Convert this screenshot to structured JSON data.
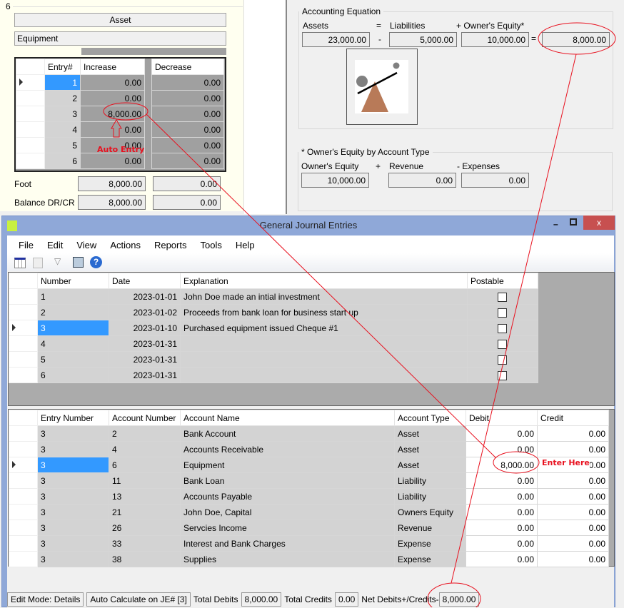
{
  "account_panel": {
    "number": "6",
    "type": "Asset",
    "name": "Equipment",
    "columns": [
      "Entry#",
      "Increase",
      "Decrease"
    ],
    "rows": [
      {
        "entry": "1",
        "inc": "0.00",
        "dec": "0.00"
      },
      {
        "entry": "2",
        "inc": "0.00",
        "dec": "0.00"
      },
      {
        "entry": "3",
        "inc": "8,000.00",
        "dec": "0.00"
      },
      {
        "entry": "4",
        "inc": "0.00",
        "dec": "0.00"
      },
      {
        "entry": "5",
        "inc": "0.00",
        "dec": "0.00"
      },
      {
        "entry": "6",
        "inc": "0.00",
        "dec": "0.00"
      }
    ],
    "foot_label": "Foot",
    "foot_inc": "8,000.00",
    "foot_dec": "0.00",
    "balance_label": "Balance DR/CR",
    "balance_inc": "8,000.00",
    "balance_dec": "0.00",
    "annotation": "Auto Entry"
  },
  "equation": {
    "title": "Accounting Equation",
    "assets_label": "Assets",
    "eq1": "=",
    "liab_label": "Liabilities",
    "oe_label": "+ Owner's Equity*",
    "assets": "23,000.00",
    "minus": "-",
    "liabilities": "5,000.00",
    "owners_equity": "10,000.00",
    "eq2": "=",
    "result": "8,000.00"
  },
  "oe_by_type": {
    "title": "* Owner's Equity by Account  Type",
    "oe_label": "Owner's Equity",
    "plus": "+",
    "rev_label": "Revenue",
    "exp_label": "- Expenses",
    "oe": "10,000.00",
    "revenue": "0.00",
    "expenses": "0.00"
  },
  "window": {
    "title": "General Journal Entries",
    "menu": [
      "File",
      "Edit",
      "View",
      "Actions",
      "Reports",
      "Tools",
      "Help"
    ]
  },
  "journal": {
    "columns": [
      "Number",
      "Date",
      "Explanation",
      "Postable"
    ],
    "rows": [
      {
        "n": "1",
        "d": "2023-01-01",
        "e": "John Doe made an intial investment"
      },
      {
        "n": "2",
        "d": "2023-01-02",
        "e": "Proceeds from bank loan for business start up"
      },
      {
        "n": "3",
        "d": "2023-01-10",
        "e": "Purchased equipment issued Cheque #1"
      },
      {
        "n": "4",
        "d": "2023-01-31",
        "e": ""
      },
      {
        "n": "5",
        "d": "2023-01-31",
        "e": ""
      },
      {
        "n": "6",
        "d": "2023-01-31",
        "e": ""
      }
    ]
  },
  "details": {
    "columns": [
      "Entry Number",
      "Account Number",
      "Account Name",
      "Account Type",
      "Debit",
      "Credit"
    ],
    "rows": [
      {
        "en": "3",
        "an": "2",
        "name": "Bank Account",
        "type": "Asset",
        "dr": "0.00",
        "cr": "0.00"
      },
      {
        "en": "3",
        "an": "4",
        "name": "Accounts Receivable",
        "type": "Asset",
        "dr": "0.00",
        "cr": "0.00"
      },
      {
        "en": "3",
        "an": "6",
        "name": "Equipment",
        "type": "Asset",
        "dr": "8,000.00",
        "cr": "0.00"
      },
      {
        "en": "3",
        "an": "11",
        "name": "Bank Loan",
        "type": "Liability",
        "dr": "0.00",
        "cr": "0.00"
      },
      {
        "en": "3",
        "an": "13",
        "name": "Accounts Payable",
        "type": "Liability",
        "dr": "0.00",
        "cr": "0.00"
      },
      {
        "en": "3",
        "an": "21",
        "name": "John Doe, Capital",
        "type": "Owners Equity",
        "dr": "0.00",
        "cr": "0.00"
      },
      {
        "en": "3",
        "an": "26",
        "name": "Servcies Income",
        "type": "Revenue",
        "dr": "0.00",
        "cr": "0.00"
      },
      {
        "en": "3",
        "an": "33",
        "name": "Interest and Bank Charges",
        "type": "Expense",
        "dr": "0.00",
        "cr": "0.00"
      },
      {
        "en": "3",
        "an": "38",
        "name": "Supplies",
        "type": "Expense",
        "dr": "0.00",
        "cr": "0.00"
      }
    ],
    "annotation": "Enter Here"
  },
  "status": {
    "edit_mode": "Edit Mode: Details",
    "auto_calc": "Auto Calculate on JE# [3]",
    "total_debits_label": "Total Debits",
    "total_debits": "8,000.00",
    "total_credits_label": "Total Credits",
    "total_credits": "0.00",
    "net_label": "Net Debits+/Credits-",
    "net": "8,000.00"
  },
  "colors": {
    "selection": "#3399ff",
    "annotation": "#e8101e",
    "titlebar": "#8fa8d8",
    "close": "#c75050"
  }
}
